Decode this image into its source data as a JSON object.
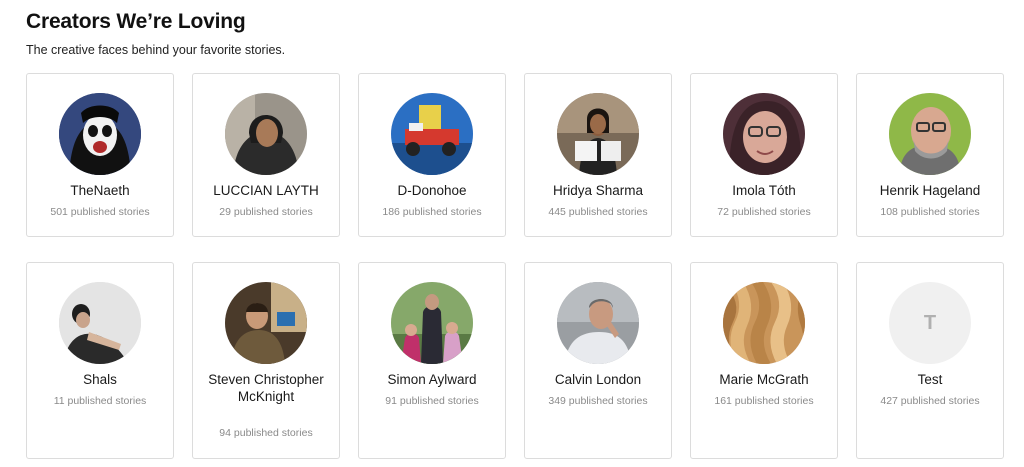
{
  "header": {
    "title": "Creators We’re Loving",
    "subtitle": "The creative faces behind your favorite stories."
  },
  "creators": [
    {
      "name": "TheNaeth",
      "stories": "501 published stories",
      "avatar": "face-paint-portrait",
      "bg": "#2a3b6e"
    },
    {
      "name": "LUCCIAN LAYTH",
      "stories": "29 published stories",
      "avatar": "hooded-man-portrait",
      "bg": "#6f6a63"
    },
    {
      "name": "D-Donohoe",
      "stories": "186 published stories",
      "avatar": "toy-vehicle-photo",
      "bg": "#2a6fc0"
    },
    {
      "name": "Hridya Sharma",
      "stories": "445 published stories",
      "avatar": "woman-holding-book-portrait",
      "bg": "#8a7a66"
    },
    {
      "name": "Imola Tóth",
      "stories": "72 published stories",
      "avatar": "woman-glasses-portrait",
      "bg": "#5e3a44"
    },
    {
      "name": "Henrik Hageland",
      "stories": "108 published stories",
      "avatar": "bearded-man-glasses-portrait",
      "bg": "#8fb848"
    },
    {
      "name": "Shals",
      "stories": "11 published stories",
      "avatar": "woman-bw-portrait",
      "bg": "#e6e6e6"
    },
    {
      "name": "Steven Christopher McKnight",
      "stories": "94 published stories",
      "avatar": "man-at-desk-photo",
      "bg": "#5a4632"
    },
    {
      "name": "Simon Aylward",
      "stories": "91 published stories",
      "avatar": "family-outdoor-photo",
      "bg": "#6d8a52"
    },
    {
      "name": "Calvin London",
      "stories": "349 published stories",
      "avatar": "man-thinking-portrait",
      "bg": "#8e9296"
    },
    {
      "name": "Marie McGrath",
      "stories": "161 published stories",
      "avatar": "wavy-hair-photo",
      "bg": "#c99a58"
    },
    {
      "name": "Test",
      "stories": "427 published stories",
      "avatar": "initial-placeholder",
      "initial": "T",
      "bg": "#f0f0f0"
    }
  ]
}
